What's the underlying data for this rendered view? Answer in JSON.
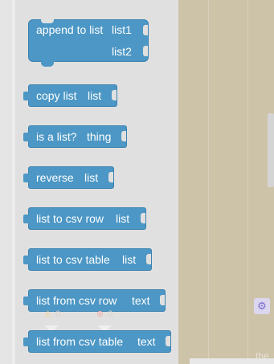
{
  "blocks": [
    {
      "id": "append",
      "label": "append to list",
      "input1": "list1",
      "input2": "list2"
    },
    {
      "id": "copy",
      "label": "copy list",
      "param": "list"
    },
    {
      "id": "is_list",
      "label": "is a list?",
      "param": "thing"
    },
    {
      "id": "reverse",
      "label": "reverse",
      "param": "list"
    },
    {
      "id": "to_csv_row",
      "label": "list to csv row",
      "param": "list"
    },
    {
      "id": "to_csv_table",
      "label": "list to csv table",
      "param": "list"
    },
    {
      "id": "from_csv_row",
      "label": "list from csv row",
      "param": "text"
    },
    {
      "id": "from_csv_table",
      "label": "list from csv table",
      "param": "text"
    }
  ],
  "indicators": {
    "warning_count": "0",
    "error_count": "0",
    "warning_icon": "warning-icon",
    "error_icon": "error-icon"
  },
  "workspace": {
    "settings_icon": "gear-icon",
    "partial_text": "the"
  },
  "colors": {
    "block": "#4c97c5",
    "flyout": "#e0e0e0",
    "workspace": "#cdc3a9"
  }
}
